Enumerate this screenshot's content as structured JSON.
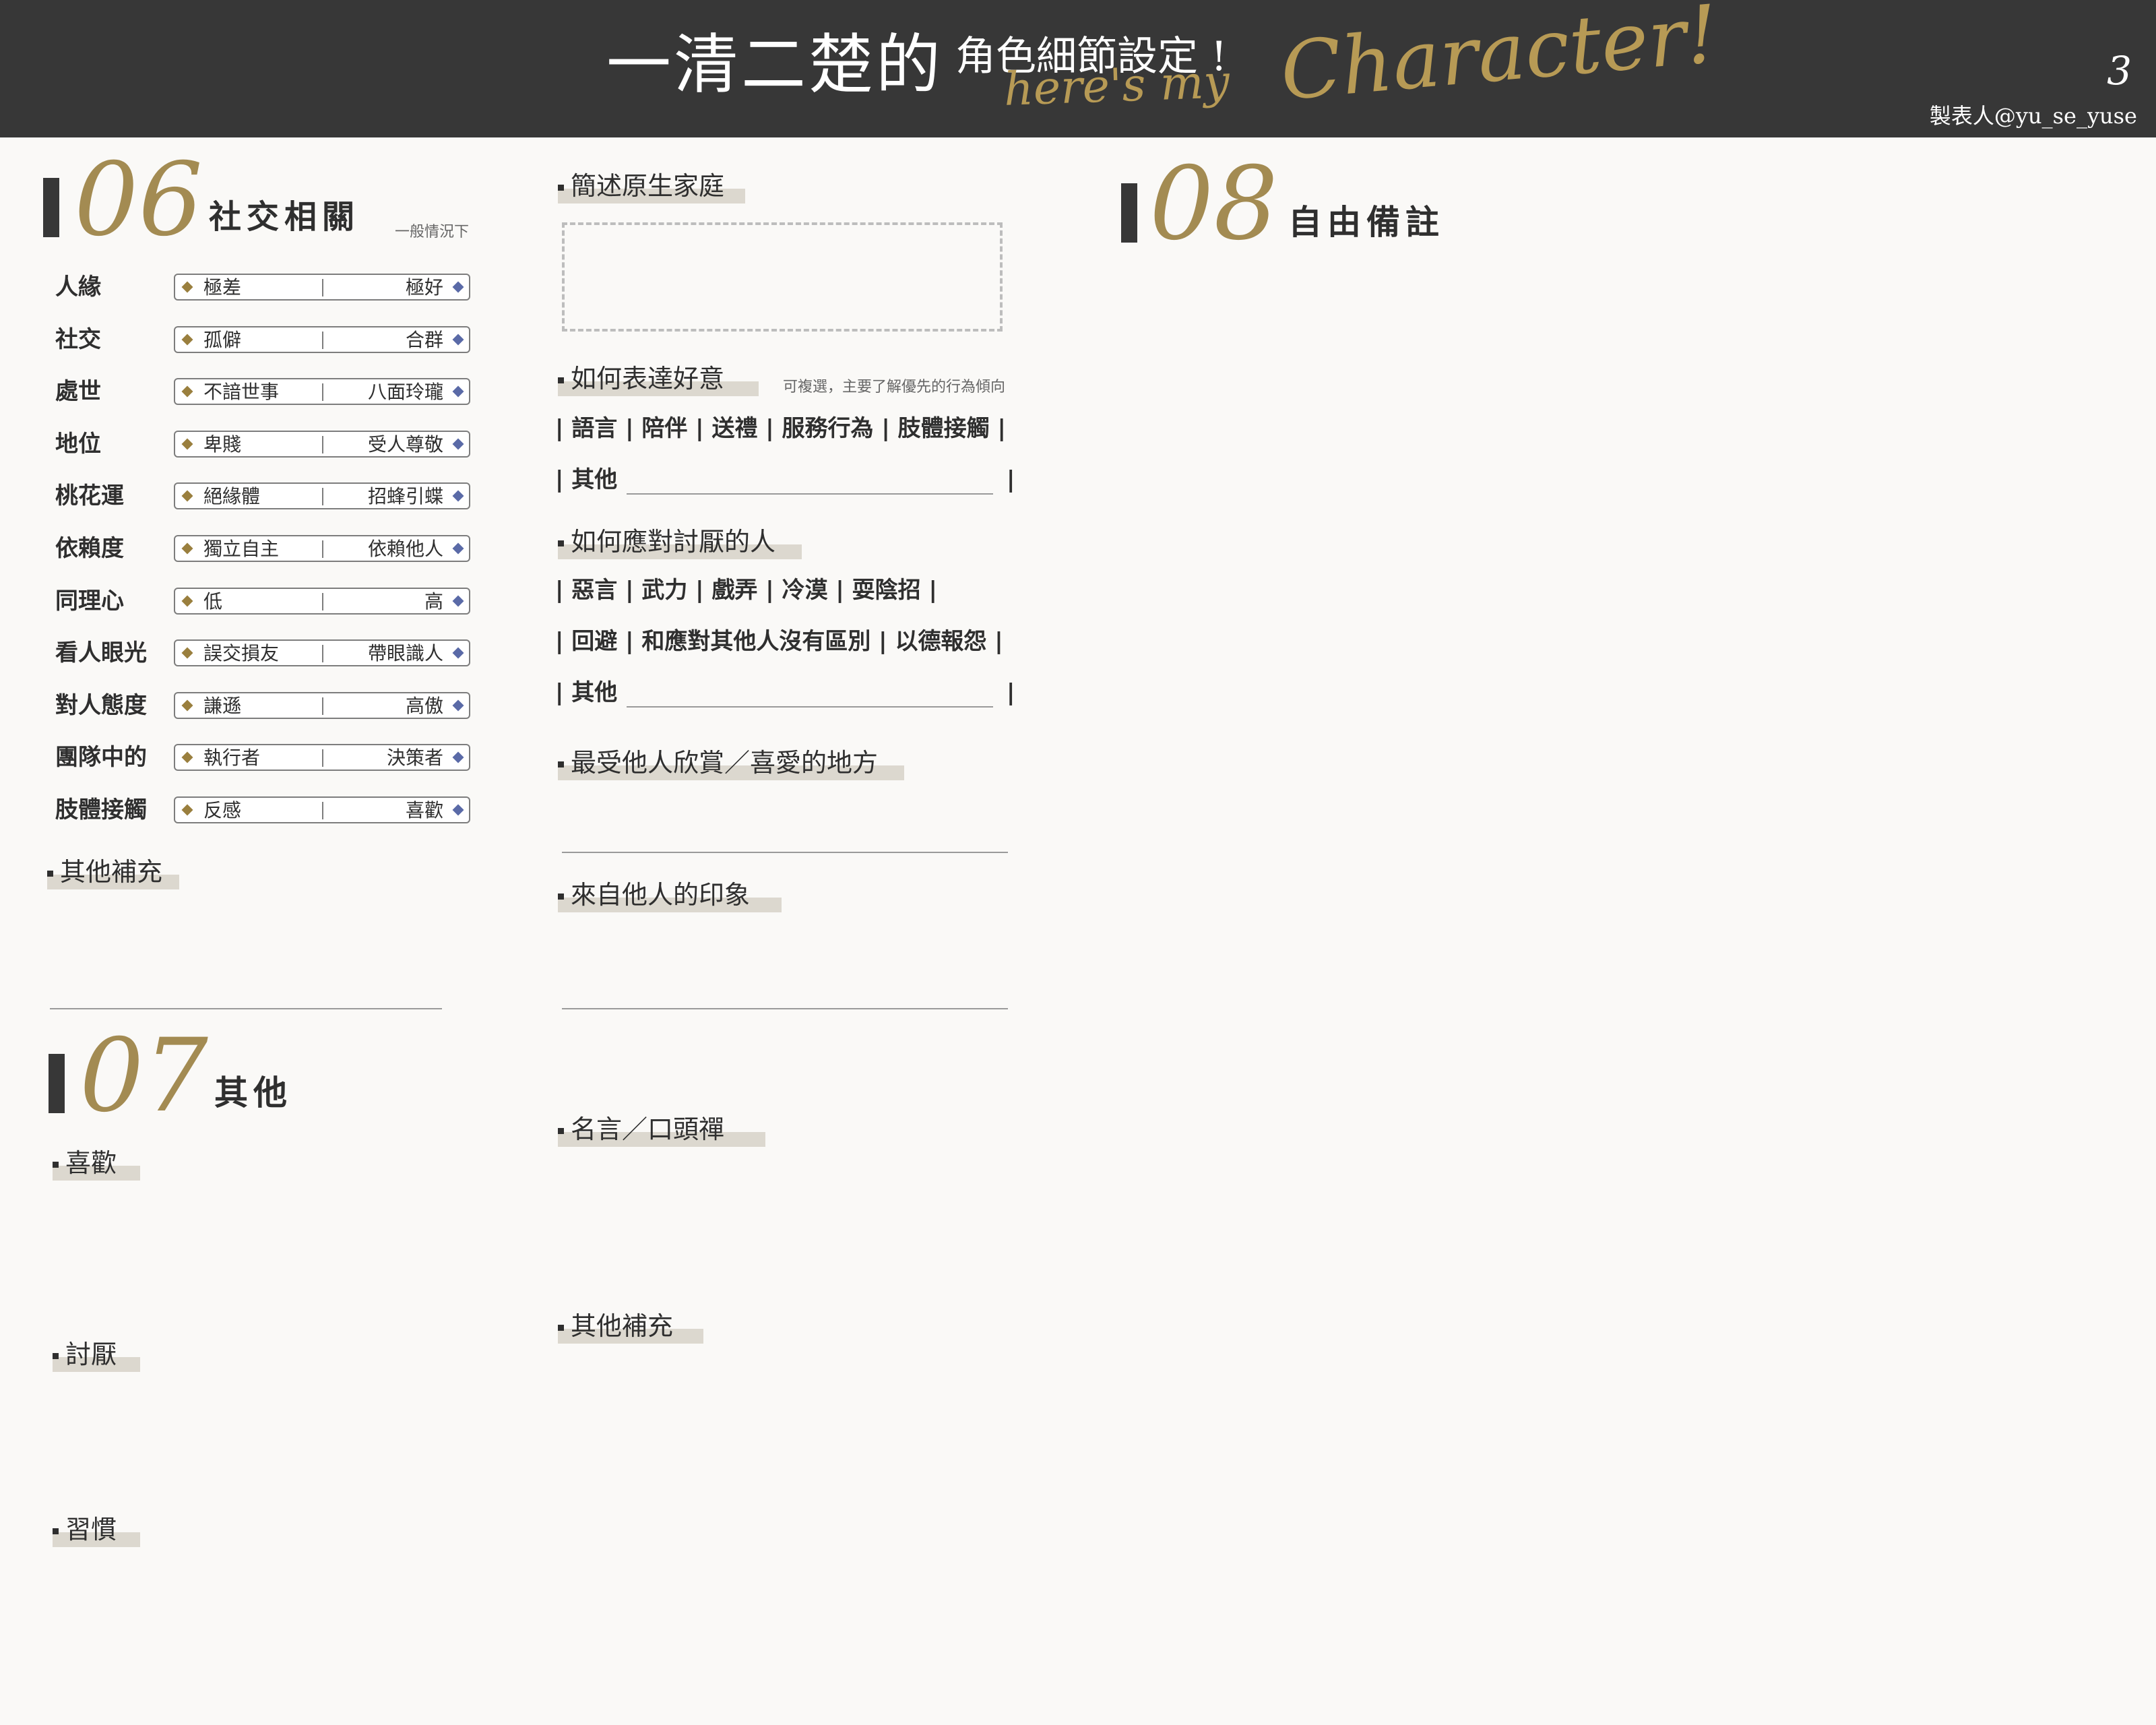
{
  "header": {
    "title_main": "一清二楚的",
    "title_sub": "角色細節設定 !",
    "script_1": "here's my",
    "script_2": "Character!",
    "page_number": "3",
    "maker": "製表人@yu_se_yuse"
  },
  "section06": {
    "number": "06",
    "title": "社交相關",
    "note": "一般情況下",
    "rows": [
      {
        "label": "人緣",
        "left": "極差",
        "right": "極好"
      },
      {
        "label": "社交",
        "left": "孤僻",
        "right": "合群"
      },
      {
        "label": "處世",
        "left": "不諳世事",
        "right": "八面玲瓏"
      },
      {
        "label": "地位",
        "left": "卑賤",
        "right": "受人尊敬"
      },
      {
        "label": "桃花運",
        "left": "絕緣體",
        "right": "招蜂引蝶"
      },
      {
        "label": "依賴度",
        "left": "獨立自主",
        "right": "依賴他人"
      },
      {
        "label": "同理心",
        "left": "低",
        "right": "高"
      },
      {
        "label": "看人眼光",
        "left": "誤交損友",
        "right": "帶眼識人"
      },
      {
        "label": "對人態度",
        "left": "謙遜",
        "right": "高傲"
      },
      {
        "label": "團隊中的",
        "left": "執行者",
        "right": "決策者"
      },
      {
        "label": "肢體接觸",
        "left": "反感",
        "right": "喜歡"
      }
    ],
    "other_supplement": "其他補充"
  },
  "section07": {
    "number": "07",
    "title": "其他",
    "likes": "喜歡",
    "dislikes": "討厭",
    "habits": "習慣"
  },
  "middle": {
    "family": "簡述原生家庭",
    "express_goodwill": "如何表達好意",
    "express_note": "可複選，主要了解優先的行為傾向",
    "goodwill_options": "| 語言 | 陪伴 | 送禮 | 服務行為 | 肢體接觸 |",
    "goodwill_other": "| 其他",
    "goodwill_other_end": "|",
    "deal_disliked": "如何應對討厭的人",
    "disliked_options_1": "| 惡言 | 武力 | 戲弄 | 冷漠 | 耍陰招 |",
    "disliked_options_2": "| 回避 | 和應對其他人沒有區別 | 以德報怨 |",
    "disliked_other": "| 其他",
    "disliked_other_end": "|",
    "most_appreciated": "最受他人欣賞／喜愛的地方",
    "impression": "來自他人的印象",
    "quote": "名言／口頭禪",
    "other_supplement": "其他補充"
  },
  "section08": {
    "number": "08",
    "title": "自由備註"
  },
  "colors": {
    "header_bg": "#373737",
    "gold": "#a38b52",
    "left_gem": "#9a7f3e",
    "right_gem": "#5a6aa7",
    "highlight": "#dcd8cf"
  }
}
